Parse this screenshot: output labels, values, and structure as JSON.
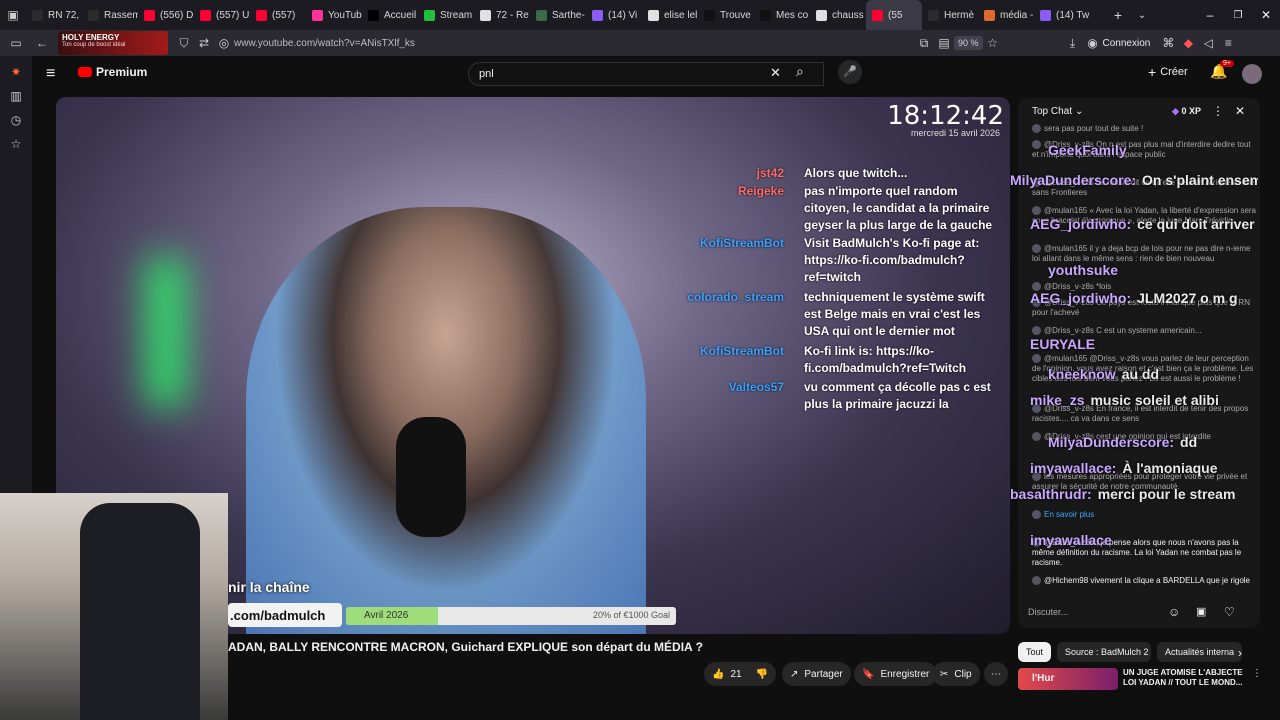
{
  "browser": {
    "tabs": [
      {
        "label": "RN 72,",
        "color": "#2b2b2b"
      },
      {
        "label": "Rassem",
        "color": "#2b2b2b"
      },
      {
        "label": "(556) D",
        "color": "#ff0033"
      },
      {
        "label": "(557) U",
        "color": "#ff0033"
      },
      {
        "label": "(557) ",
        "color": "#ff0033"
      },
      {
        "label": "YouTub",
        "color": "#ff3399"
      },
      {
        "label": "Accueil",
        "color": "#000000"
      },
      {
        "label": "Stream",
        "color": "#1fbf3f"
      },
      {
        "label": "72 - Re",
        "color": "#e0e0e0"
      },
      {
        "label": "Sarthe-",
        "color": "#3a6a4a"
      },
      {
        "label": "(14) Vi",
        "color": "#8a5cf6"
      },
      {
        "label": "elise lel",
        "color": "#e0e0e0"
      },
      {
        "label": "Trouve",
        "color": "#111111"
      },
      {
        "label": "Mes co",
        "color": "#111111"
      },
      {
        "label": "chauss",
        "color": "#e0e0e0"
      },
      {
        "label": "(55",
        "color": "#ff0033"
      },
      {
        "label": "Hermè",
        "color": "#2b2b2b"
      },
      {
        "label": "média -",
        "color": "#e06a2b"
      },
      {
        "label": "(14) Tw",
        "color": "#8a5cf6"
      }
    ],
    "new_tab": "+",
    "url": "www.youtube.com/watch?v=ANisTXlf_ks",
    "zoom": "90 %",
    "signin": "Connexion",
    "notif_badge": "9+"
  },
  "ad_logo": {
    "title": "HOLY ENERGY",
    "sub": "Ton coup de boost idéal"
  },
  "youtube": {
    "brand": "Premium",
    "search_value": "pnl",
    "create_label": "Créer",
    "notif_badge": "9+"
  },
  "stream_overlay": {
    "clock": "18:12:42",
    "date": "mercredi 15 avril 2026",
    "goal_month": "Avril 2026",
    "goal_text": "20% of €1000 Goal",
    "goal_progress": 0.2,
    "link_partial": ".com/badmulch",
    "join_partial": "nir la chaîne",
    "chat": [
      {
        "name": "jst42",
        "name_color": "#ff6b6b",
        "text": "Alors que twitch..."
      },
      {
        "name": "Reigeke",
        "name_color": "#ff6b6b",
        "text": "pas n'importe quel random citoyen, le candidat a la primaire geyser la plus large de la gauche"
      },
      {
        "name": "KofiStreamBot",
        "name_color": "#3aa0ff",
        "text": "Visit BadMulch's Ko-fi page at: https://ko-fi.com/badmulch?ref=twitch"
      },
      {
        "name": "colorado_stream",
        "name_color": "#3aa0ff",
        "text": "techniquement le système swift est Belge mais en vrai c'est les USA qui ont le dernier mot"
      },
      {
        "name": "KofiStreamBot",
        "name_color": "#3aa0ff",
        "text": "Ko-fi link is: https://ko-fi.com/badmulch?ref=Twitch"
      },
      {
        "name": "Valteos57",
        "name_color": "#3aa0ff",
        "text": "vu comment ça décolle pas c est plus la primaire jacuzzi la"
      }
    ]
  },
  "chat_panel": {
    "header": "Top Chat",
    "xp": "0 XP",
    "input_placeholder": "Discuter...",
    "messages": [
      {
        "text": "sera pas pour tout de suite !"
      },
      {
        "text": "@Driss_v-z8s  On n est pas plus mal d'interdire dedire tout et n'importe quoi dans i espace public"
      },
      {
        "text": "@Driss_v-z8s  La russie dit ce qu'elle veut en Afrique et elle sans Frontieres"
      },
      {
        "text": "@mulan165  « Avec la loi Yadan, la liberté d'expression sera sous bracelet électronique », alerte le juge Marc Trévidic."
      },
      {
        "text": "@mulan165 il y a deja bcp de lois pour ne pas dire n-ieme loi allant dans le même sens : rien de bien nouveau"
      },
      {
        "text": "@Driss_v-z8s  *lois"
      },
      {
        "text": "@Driss_v-z8s  Ce pays est foutu il manque plus que le RN pour l'achevé"
      },
      {
        "text": "@Driss_v-z8s  C est un systeme americain..."
      },
      {
        "text": "@mulan165  @Driss_v-z8s vous parlez de leur perception de l'opinion, vous avez raison et c'est bien ça le problème. Les cibles des lois dont vous parlez : La est aussi le problème !"
      },
      {
        "text": "@Driss_v-z8s  En france, il est interdit de tenir des propos racistes.... ca va dans ce sens"
      },
      {
        "text": "@Driss_v-z8s  cest une opinion qui est interdite"
      },
      {
        "text": "les mesures appropriées pour protéger votre vie privée et assurer la sécurité de notre communauté."
      },
      {
        "text": "En savoir plus"
      },
      {
        "text": "@Driss_v-z8s , je pense alors que nous n'avons pas la même définition du racisme. La loi Yadan ne combat pas le racisme."
      },
      {
        "text": "@Hichem98  vivement la clique a BARDELLA que je rigole"
      }
    ],
    "overlay_chat": [
      {
        "name": "GeekFamily",
        "text": ""
      },
      {
        "name": "MilyaDunderscore:",
        "text": "On s'plaint ensemble mdr"
      },
      {
        "name": "AEG_jordiwho:",
        "text": "ce qui doit arriver va arriver"
      },
      {
        "name": "youthsuke",
        "text": ""
      },
      {
        "name": "AEG_jordiwho:",
        "text": "JLM2027 o m g"
      },
      {
        "name": "EURYALE",
        "text": ""
      },
      {
        "name": "kneeknow",
        "text": "au dd"
      },
      {
        "name": "mike_zs",
        "text": "music soleil et alibi"
      },
      {
        "name": "MilyaDunderscore:",
        "text": "dd"
      },
      {
        "name": "imyawallace:",
        "text": "À l'amoniaque"
      },
      {
        "name": "basalthrudr:",
        "text": "merci pour le stream"
      },
      {
        "name": "imyawallace",
        "text": ""
      }
    ]
  },
  "video_meta": {
    "title": "ADAN, BALLY RENCONTRE MACRON, Guichard EXPLIQUE son départ du MÉDIA ?",
    "likes": "21",
    "share": "Partager",
    "save": "Enregistrer",
    "clip": "Clip"
  },
  "chips": [
    "Tout",
    "Source : BadMulch 2",
    "Actualités interna"
  ],
  "reco": {
    "title": "UN JUGE ATOMISE L'ABJECTE LOI YADAN // TOUT LE MOND...",
    "thumb_text": "l'Hur"
  }
}
